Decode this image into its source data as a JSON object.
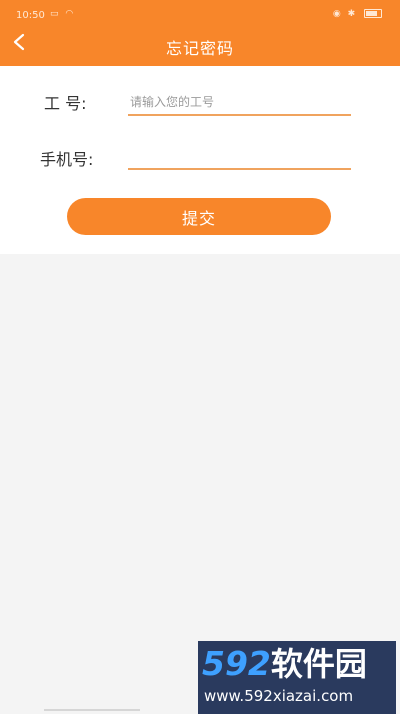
{
  "status_bar": {
    "time": "10:50",
    "left_icons": [
      "sim-icon",
      "wifi-icon"
    ],
    "right_icons": [
      "eye-icon",
      "bluetooth-icon",
      "battery-icon"
    ]
  },
  "header": {
    "title": "忘记密码",
    "back_icon": "chevron-left-icon",
    "background_color": "#f8862a"
  },
  "form": {
    "employee_id": {
      "label": "工  号:",
      "placeholder": "请输入您的工号",
      "value": ""
    },
    "phone": {
      "label": "手机号:",
      "placeholder": "",
      "value": ""
    },
    "submit_label": "提交"
  },
  "watermark": {
    "logo_text": "592软件园",
    "url": "www.592xiazai.com"
  },
  "colors": {
    "accent": "#f8862a",
    "input_underline": "#f0a35e",
    "page_background": "#f4f4f4"
  }
}
